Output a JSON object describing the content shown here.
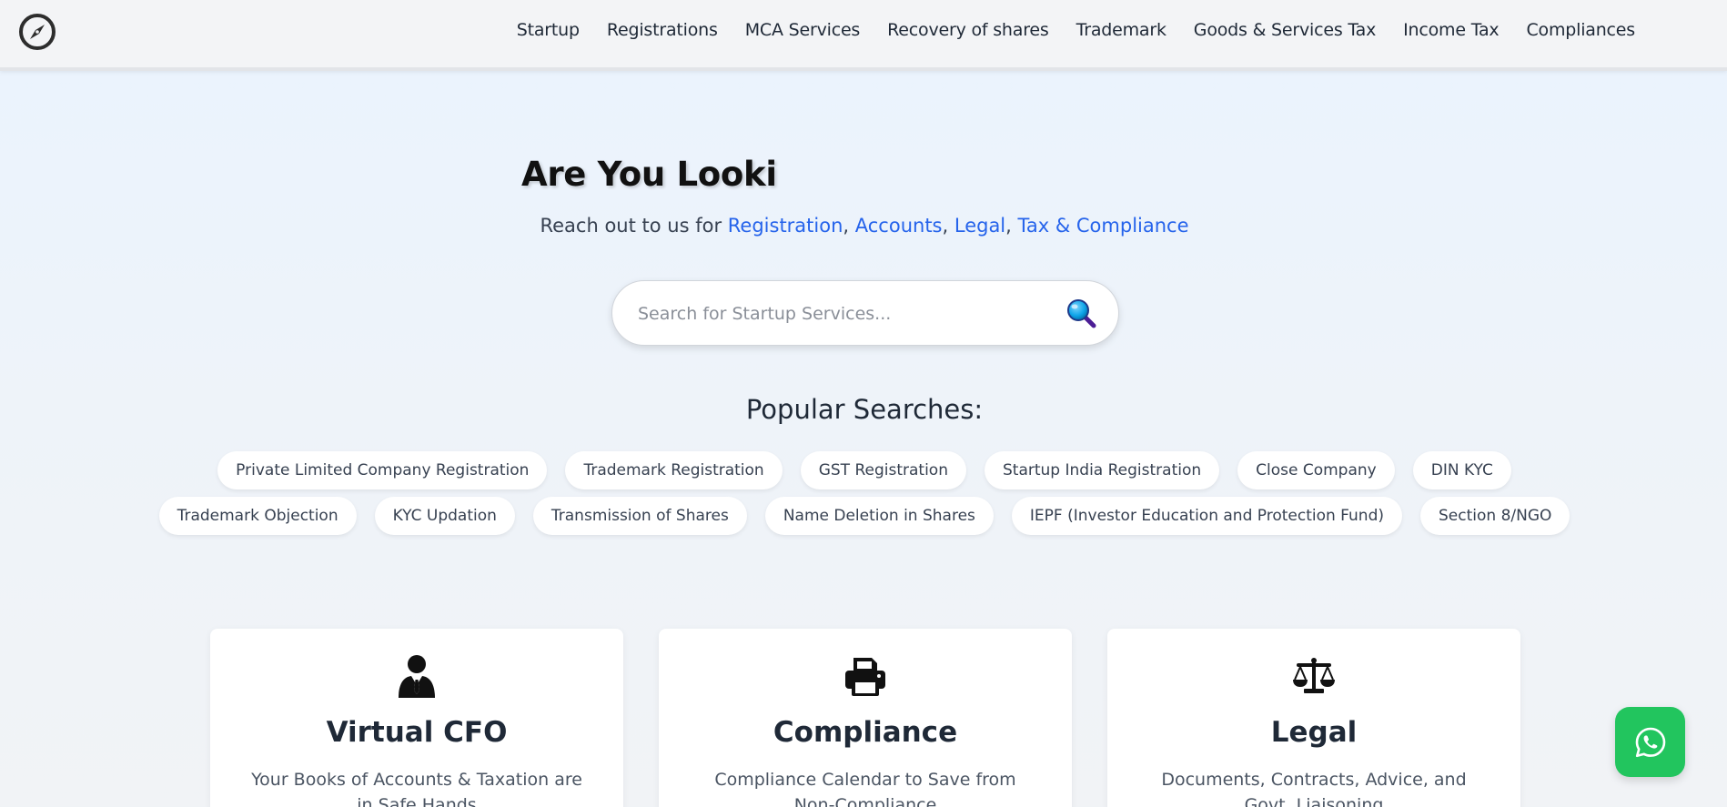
{
  "nav": {
    "items": [
      {
        "label": "Startup"
      },
      {
        "label": "Registrations"
      },
      {
        "label": "MCA Services"
      },
      {
        "label": "Recovery of shares"
      },
      {
        "label": "Trademark"
      },
      {
        "label": "Goods & Services Tax"
      },
      {
        "label": "Income Tax"
      },
      {
        "label": "Compliances"
      }
    ]
  },
  "hero": {
    "title": "Are You Looki",
    "subtitle_prefix": "Reach out to us for ",
    "highlights": [
      "Registration",
      "Accounts",
      "Legal",
      "Tax & Compliance"
    ],
    "separator": ", "
  },
  "search": {
    "placeholder": "Search for Startup Services...",
    "value": ""
  },
  "popular": {
    "title": "Popular Searches:",
    "row1": [
      "Private Limited Company Registration",
      "Trademark Registration",
      "GST Registration",
      "Startup India Registration",
      "Close Company",
      "DIN KYC"
    ],
    "row2": [
      "Trademark Objection",
      "KYC Updation",
      "Transmission of Shares",
      "Name Deletion in Shares",
      "IEPF (Investor Education and Protection Fund)",
      "Section 8/NGO"
    ]
  },
  "cards": [
    {
      "title": "Virtual CFO",
      "desc": "Your Books of Accounts & Taxation are in Safe Hands",
      "icon": "person-tie-icon"
    },
    {
      "title": "Compliance",
      "desc": "Compliance Calendar to Save from Non-Compliance",
      "icon": "printer-icon"
    },
    {
      "title": "Legal",
      "desc": "Documents, Contracts, Advice, and Govt. Liaisoning",
      "icon": "scale-icon"
    }
  ],
  "colors": {
    "accent": "#2563eb",
    "whatsapp": "#22c55e"
  }
}
